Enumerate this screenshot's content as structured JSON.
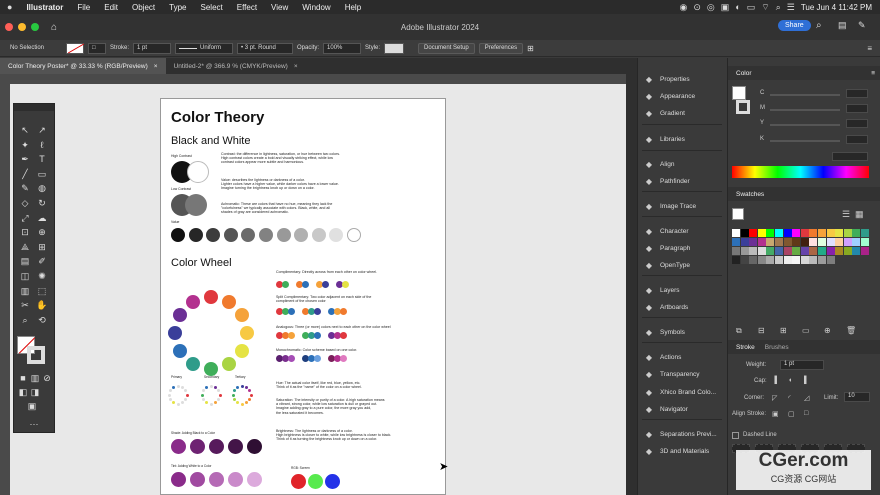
{
  "menubar": {
    "app": "Illustrator",
    "items": [
      "File",
      "Edit",
      "Object",
      "Type",
      "Select",
      "Effect",
      "View",
      "Window",
      "Help"
    ],
    "clock": "Tue Jun 4  11:42 PM"
  },
  "titlebar": {
    "title": "Adobe Illustrator 2024",
    "share": "Share"
  },
  "control": {
    "selection": "No Selection",
    "stroke_label": "Stroke:",
    "stroke_value": "1 pt",
    "profile": "Uniform",
    "brush": "3 pt. Round",
    "opacity_label": "Opacity:",
    "opacity_value": "100%",
    "style_label": "Style:",
    "doc_setup": "Document Setup",
    "preferences": "Preferences"
  },
  "tabs": [
    {
      "label": "Color Theory Poster* @ 33.33 % (RGB/Preview)",
      "close": "×"
    },
    {
      "label": "Untitled-2* @ 366.9 % (CMYK/Preview)",
      "close": "×"
    }
  ],
  "poster": {
    "title": "Color Theory",
    "bw_heading": "Black and White",
    "high_contrast": "High Contrast",
    "low_contrast": "Low Contrast",
    "value_label": "Value",
    "contrast_text": "Contrast: the difference in lightness, saturation, or hue between two colors.\nHigh contrast colors create a bold and visually striking effect, while low\ncontrast colors appear more subtle and harmonious.",
    "value_text": "Value: describes the lightness or darkness of a color.\nLighter colors have a higher value, while darker colors have a lower value.\nImagine turning the brightness knob up or down on a color.",
    "achromatic_text": "Achromatic: These are colors that have no hue, meaning they lack the\n\"colorfulness\" we typically associate with colors. Black, white, and all\nshades of gray are considered achromatic.",
    "wheel_heading": "Color Wheel",
    "complementary": "Complimentary: Directly across from each other on color wheel.",
    "split": "Split Complimentary: Two color adjacent on each side of the\ncompliment of the chosen color",
    "analogous": "Analogous: Three (or more) colors next to each other on the color wheel",
    "mono": "Monochromatic: Color scheme based on one color.",
    "primary": "Primary",
    "secondary": "Secondary",
    "tertiary": "Tertiary",
    "hue_text": "Hue: The actual color itself, like red, blue, yellow, etc.\nThink of it as the \"name\" of the color on a color wheel.",
    "sat_text": "Saturation: The intensity or purity of a color. A high saturation means\na vibrant, strong color, while low saturation is dull or grayed out.\nImagine adding gray to a pure color, the more gray you add,\nthe less saturated it becomes.",
    "bright_text": "Brightness: The lightness or darkness of a color.\nHigh brightness is closer to white, while low brightness is closer to black.\nThink of it as turning the brightness knob up or down on a color.",
    "shade_label": "Shade: Adding Black to a Color",
    "tint_label": "Tint: Adding White to a Color",
    "rgb_label": "RGB: Screen"
  },
  "panel_col1": [
    {
      "label": "Properties",
      "icon": "properties-icon"
    },
    {
      "label": "Appearance",
      "icon": "appearance-icon"
    },
    {
      "label": "Gradient",
      "icon": "gradient-icon"
    },
    {
      "label": "Libraries",
      "icon": "libraries-icon"
    },
    {
      "label": "Align",
      "icon": "align-icon"
    },
    {
      "label": "Pathfinder",
      "icon": "pathfinder-icon"
    },
    {
      "label": "Image Trace",
      "icon": "image-trace-icon"
    },
    {
      "label": "Character",
      "icon": "character-icon"
    },
    {
      "label": "Paragraph",
      "icon": "paragraph-icon"
    },
    {
      "label": "OpenType",
      "icon": "opentype-icon"
    },
    {
      "label": "Layers",
      "icon": "layers-icon"
    },
    {
      "label": "Artboards",
      "icon": "artboards-icon"
    },
    {
      "label": "Symbols",
      "icon": "symbols-icon"
    },
    {
      "label": "Actions",
      "icon": "actions-icon"
    },
    {
      "label": "Transparency",
      "icon": "transparency-icon"
    },
    {
      "label": "Xhico Brand Colo...",
      "icon": "brand-colors-icon"
    },
    {
      "label": "Navigator",
      "icon": "navigator-icon"
    },
    {
      "label": "Separations Previ...",
      "icon": "separations-icon"
    },
    {
      "label": "3D and Materials",
      "icon": "3d-icon"
    }
  ],
  "color_panel": {
    "title": "Color",
    "c": "C",
    "m": "M",
    "y": "Y",
    "k": "K"
  },
  "swatches_panel": {
    "title": "Swatches"
  },
  "stroke_panel": {
    "tab1": "Stroke",
    "tab2": "Brushes",
    "weight_label": "Weight:",
    "weight_value": "1 pt",
    "cap_label": "Cap:",
    "corner_label": "Corner:",
    "limit_label": "Limit:",
    "limit_value": "10",
    "align_label": "Align Stroke:",
    "dashed_label": "Dashed Line"
  },
  "watermark": {
    "main": "CGer.com",
    "sub": "CG资源 CG网站"
  },
  "colors": {
    "accent": "#2f6fd6",
    "panel": "#3a3a3a",
    "canvas": "#e8e8e8"
  }
}
